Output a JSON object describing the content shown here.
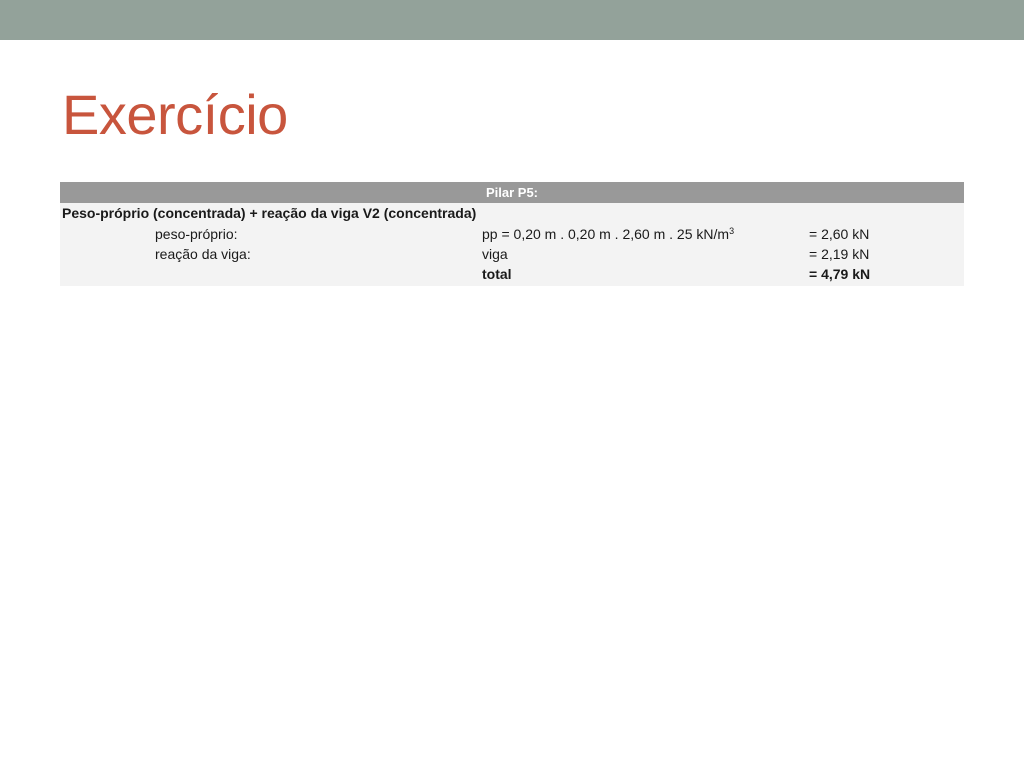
{
  "slide": {
    "title": "Exercício"
  },
  "table": {
    "header": "Pilar P5:",
    "section_title": "Peso-próprio (concentrada) + reação da viga V2 (concentrada)",
    "rows": [
      {
        "label": "peso-próprio:",
        "formula": "pp = 0,20 m . 0,20 m . 2,60 m . 25 kN/m",
        "formula_sup": "3",
        "result": "= 2,60 kN"
      },
      {
        "label": "reação da viga:",
        "formula": "viga",
        "result": "= 2,19 kN"
      },
      {
        "formula": "total",
        "result": "= 4,79 kN"
      }
    ]
  },
  "colors": {
    "top_bar": "#93a29a",
    "title": "#c8553d",
    "table_header": "#999999",
    "table_body": "#f3f3f3"
  }
}
